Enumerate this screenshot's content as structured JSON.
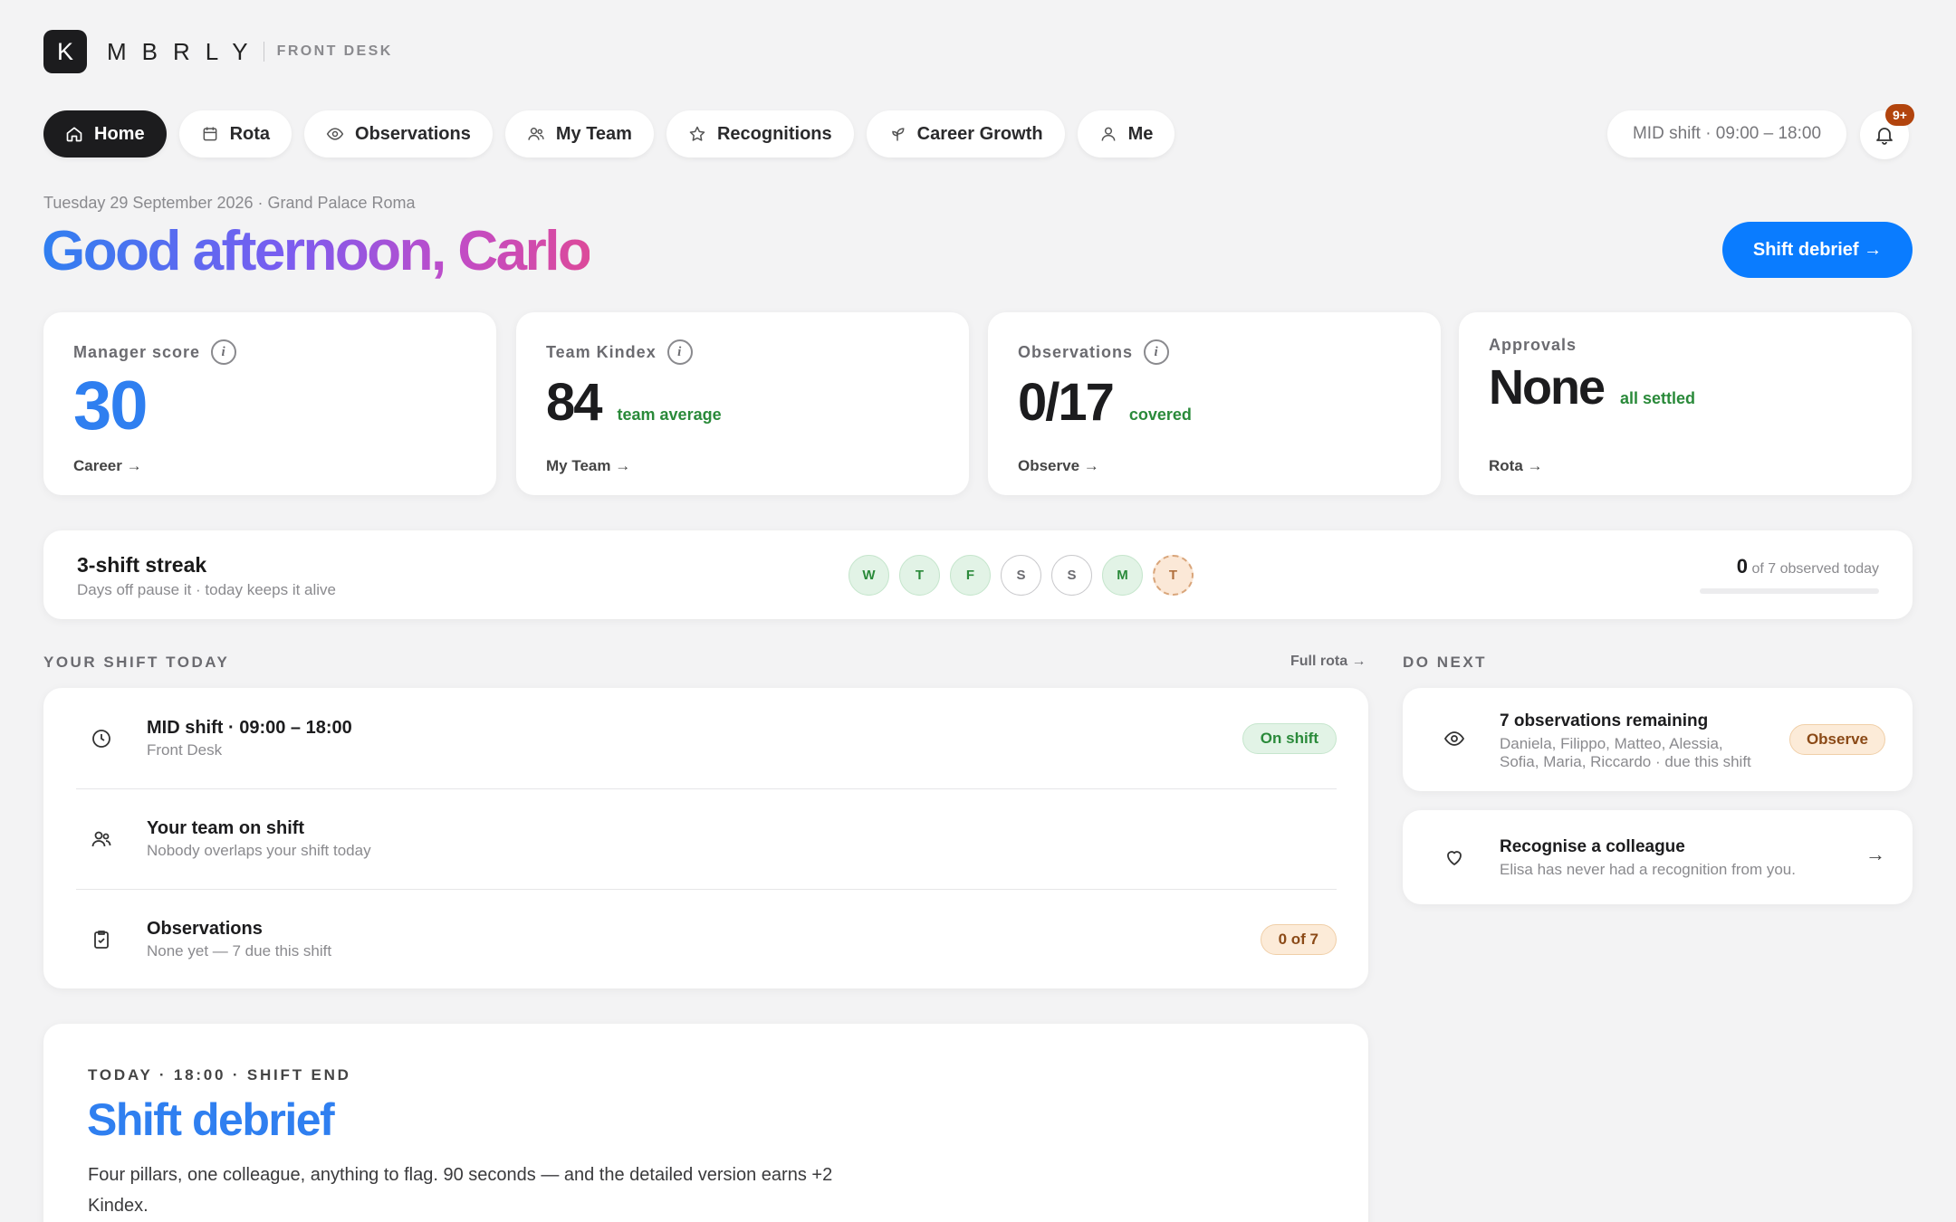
{
  "brand": {
    "mark": "K",
    "name": "MBRLY",
    "sub": "FRONT DESK"
  },
  "nav": [
    {
      "label": "Home",
      "icon": "home-icon",
      "active": true
    },
    {
      "label": "Rota",
      "icon": "calendar-icon"
    },
    {
      "label": "Observations",
      "icon": "eye-icon"
    },
    {
      "label": "My Team",
      "icon": "team-icon"
    },
    {
      "label": "Recognitions",
      "icon": "star-icon"
    },
    {
      "label": "Career Growth",
      "icon": "sprout-icon"
    },
    {
      "label": "Me",
      "icon": "user-icon"
    }
  ],
  "header": {
    "shift_pill": "MID shift · 09:00 – 18:00",
    "notifications_badge": "9+"
  },
  "greeting": {
    "dateline": "Tuesday 29 September 2026 · Grand Palace Roma",
    "title": "Good afternoon, Carlo",
    "debrief_button": "Shift debrief →"
  },
  "stats": [
    {
      "label": "Manager score",
      "value": "30",
      "sub": "",
      "link": "Career →",
      "info": "i"
    },
    {
      "label": "Team Kindex",
      "value": "84",
      "sub": "team average",
      "link": "My Team →",
      "info": "i"
    },
    {
      "label": "Observations",
      "value": "0/17",
      "sub": "covered",
      "link": "Observe →",
      "info": "i"
    },
    {
      "label": "Approvals",
      "value": "None",
      "sub": "all settled",
      "link": "Rota →"
    }
  ],
  "streak": {
    "title": "3-shift streak",
    "subtitle": "Days off pause it · today keeps it alive",
    "days": [
      {
        "letter": "W",
        "state": "done"
      },
      {
        "letter": "T",
        "state": "done"
      },
      {
        "letter": "F",
        "state": "done"
      },
      {
        "letter": "S",
        "state": "off"
      },
      {
        "letter": "S",
        "state": "off"
      },
      {
        "letter": "M",
        "state": "done"
      },
      {
        "letter": "T",
        "state": "today"
      }
    ],
    "observed_count": "0",
    "observed_text": "of 7 observed today",
    "observed_progress": 0
  },
  "shift_today": {
    "heading": "YOUR SHIFT TODAY",
    "link": "Full rota →",
    "rows": [
      {
        "title": "MID shift · 09:00 – 18:00",
        "sub": "Front Desk",
        "badge": "On shift",
        "icon": "clock-icon"
      },
      {
        "title": "Your team on shift",
        "sub": "Nobody overlaps your shift today",
        "badge": "",
        "icon": "team-icon"
      },
      {
        "title": "Observations",
        "sub": "None yet — 7 due this shift",
        "badge": "0 of 7",
        "icon": "clipboard-check-icon"
      }
    ]
  },
  "do_next": {
    "heading": "DO NEXT",
    "items": [
      {
        "title": "7 observations remaining",
        "sub_line1": "Daniela, Filippo, Matteo, Alessia,",
        "sub_line2": "Sofia, Maria, Riccardo · due this shift",
        "action": "Observe",
        "icon": "eye-icon"
      },
      {
        "title": "Recognise a colleague",
        "sub": "Elisa has never had a recognition from you.",
        "action": "→",
        "icon": "heart-icon"
      }
    ]
  },
  "debrief": {
    "eyebrow": "TODAY · 18:00 · SHIFT END",
    "title": "Shift debrief",
    "body": "Four pillars, one colleague, anything to flag. 90 seconds — and the detailed version earns +2 Kindex."
  },
  "colors": {
    "accent": "#0a7cff",
    "success": "#2a8a3a",
    "warning": "#8b4a17",
    "badge": "#b2440d"
  }
}
